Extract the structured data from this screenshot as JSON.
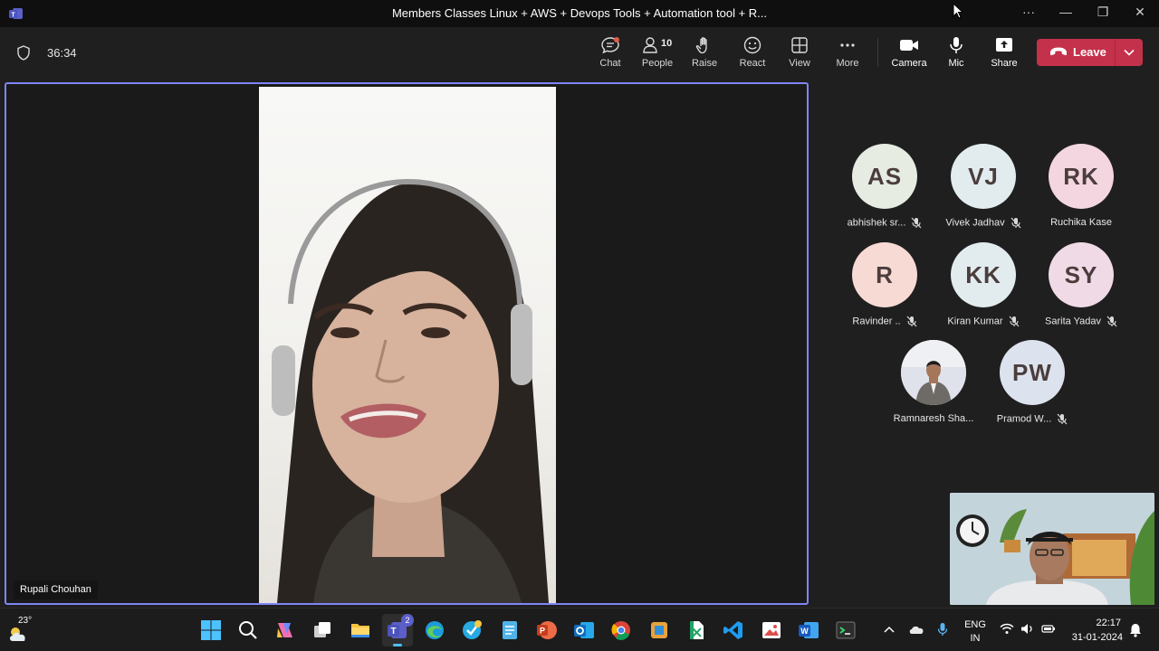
{
  "window": {
    "title": "Members Classes Linux + AWS + Devops Tools + Automation tool + R...",
    "more_glyph": "···",
    "minimize_glyph": "—",
    "maximize_glyph": "❐",
    "close_glyph": "✕"
  },
  "meeting": {
    "timer": "36:34",
    "toolbar": {
      "chat": "Chat",
      "people": "People",
      "people_count": "10",
      "raise": "Raise",
      "react": "React",
      "view": "View",
      "more": "More",
      "camera": "Camera",
      "mic": "Mic",
      "share": "Share",
      "leave": "Leave"
    },
    "speaker_name": "Rupali Chouhan",
    "participants": [
      {
        "initials": "AS",
        "name": "abhishek sr...",
        "muted": true,
        "color": "#e6ece2"
      },
      {
        "initials": "VJ",
        "name": "Vivek Jadhav",
        "muted": true,
        "color": "#e2ecee"
      },
      {
        "initials": "RK",
        "name": "Ruchika Kase",
        "muted": false,
        "color": "#f3d6e0"
      },
      {
        "initials": "R",
        "name": "Ravinder ..",
        "muted": true,
        "color": "#f8dad4"
      },
      {
        "initials": "KK",
        "name": "Kiran Kumar",
        "muted": true,
        "color": "#e2ecee"
      },
      {
        "initials": "SY",
        "name": "Sarita Yadav",
        "muted": true,
        "color": "#f0dae6"
      },
      {
        "initials": "",
        "name": "Ramnaresh Sha...",
        "muted": false,
        "color": "#e9e9ef",
        "photo": true
      },
      {
        "initials": "PW",
        "name": "Pramod W...",
        "muted": true,
        "color": "#dde3ee"
      }
    ]
  },
  "colors": {
    "accent": "#7f85f5",
    "leave": "#c4314b",
    "background": "#1f1f1f"
  },
  "taskbar": {
    "weather_temp": "23°",
    "language_top": "ENG",
    "language_bottom": "IN",
    "time": "22:17",
    "date": "31-01-2024",
    "teams_badge": "2"
  }
}
